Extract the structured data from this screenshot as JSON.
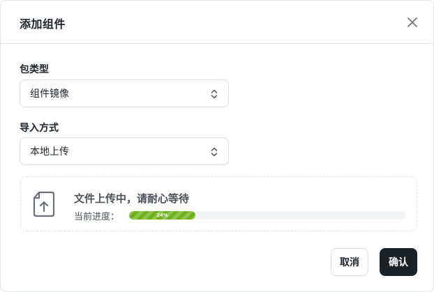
{
  "dialog": {
    "title": "添加组件",
    "close_icon": "close-icon"
  },
  "form": {
    "package_type": {
      "label": "包类型",
      "selected": "组件镜像",
      "icon": "chevron-up-down-icon"
    },
    "import_method": {
      "label": "导入方式",
      "selected": "本地上传",
      "icon": "chevron-up-down-icon"
    }
  },
  "upload": {
    "icon": "file-upload-icon",
    "status_text": "文件上传中，请耐心等待",
    "progress_label": "当前进度：",
    "progress_percent": 24,
    "progress_text": "24%",
    "progress_color": "#6cb31b"
  },
  "footer": {
    "cancel_label": "取消",
    "confirm_label": "确认",
    "confirm_color": "#1d2226"
  }
}
